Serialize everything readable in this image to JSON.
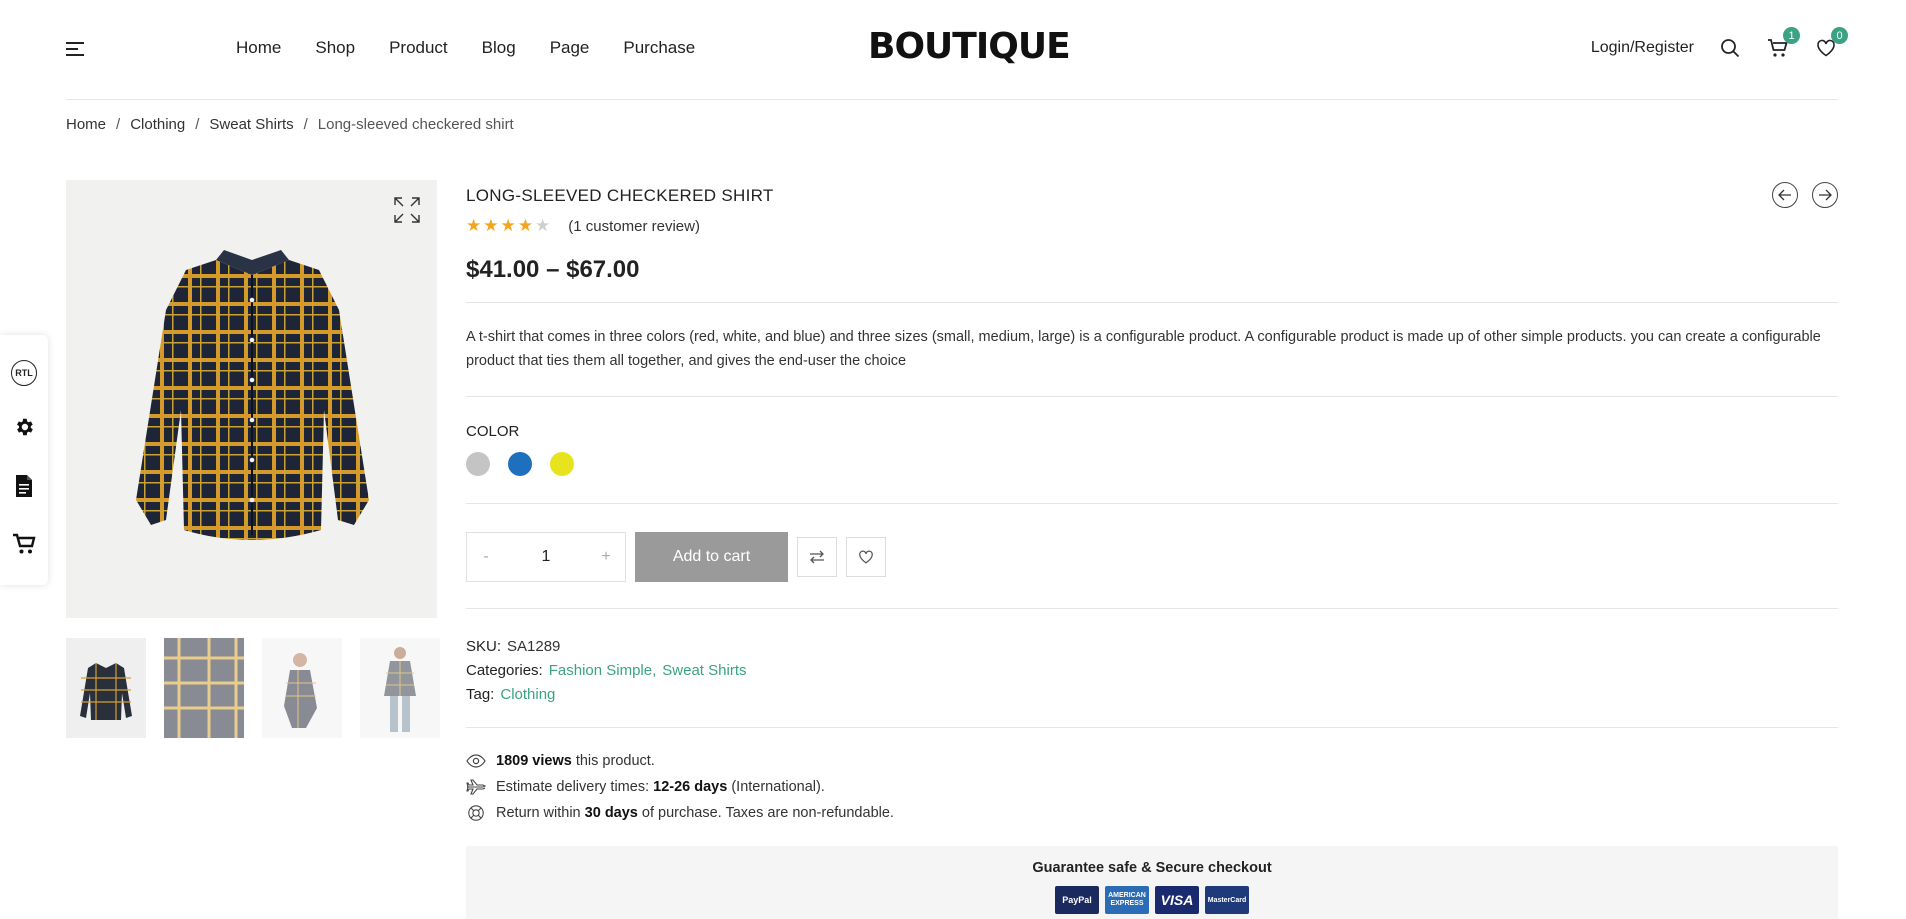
{
  "header": {
    "logo": "BOUTIQUE",
    "nav": [
      "Home",
      "Shop",
      "Product",
      "Blog",
      "Page",
      "Purchase"
    ],
    "login_label": "Login/Register",
    "cart_count": "1",
    "wishlist_count": "0"
  },
  "breadcrumb": {
    "items": [
      "Home",
      "Clothing",
      "Sweat Shirts"
    ],
    "current": "Long-sleeved checkered shirt",
    "separator": "/"
  },
  "sidebar_tools": {
    "rtl_label": "RTL"
  },
  "product": {
    "title": "LONG-SLEEVED CHECKERED SHIRT",
    "rating": 4,
    "rating_max": 5,
    "review_text": "(1 customer review)",
    "price": "$41.00 – $67.00",
    "description": "A t-shirt that comes in three colors (red, white, and blue) and three sizes (small, medium, large) is a configurable product. A configurable product is made up of other simple products. you can create a configurable product that ties them all together, and gives the end-user the choice",
    "color_label": "COLOR",
    "colors": [
      "#c4c4c4",
      "#1f6fbf",
      "#e8e31f"
    ],
    "quantity": "1",
    "qty_minus": "-",
    "qty_plus": "+",
    "add_to_cart": "Add to cart",
    "sku_label": "SKU:",
    "sku": "SA1289",
    "categories_label": "Categories:",
    "categories": [
      "Fashion Simple",
      "Sweat Shirts"
    ],
    "tag_label": "Tag:",
    "tag": "Clothing",
    "views_count": "1809 views",
    "views_suffix": "this product.",
    "delivery_prefix": "Estimate delivery times:",
    "delivery_days": "12-26 days",
    "delivery_suffix": "(International).",
    "return_prefix": "Return within",
    "return_days": "30 days",
    "return_suffix": "of purchase. Taxes are non-refundable."
  },
  "checkout": {
    "title": "Guarantee safe & Secure checkout",
    "payments": [
      "PayPal",
      "AMERICAN EXPRESS",
      "VISA",
      "MasterCard"
    ]
  },
  "colors": {
    "accent": "#3aa383",
    "star": "#f3a51d",
    "button_gray": "#9a9a9a"
  }
}
